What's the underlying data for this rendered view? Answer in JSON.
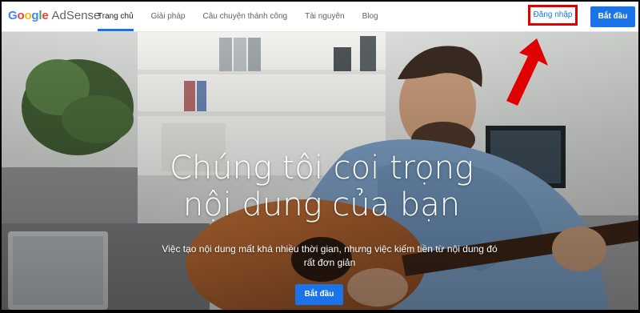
{
  "header": {
    "logo_google": [
      "G",
      "o",
      "o",
      "g",
      "l",
      "e"
    ],
    "logo_product": "AdSense",
    "nav": [
      {
        "label": "Trang chủ",
        "active": true
      },
      {
        "label": "Giải pháp",
        "active": false
      },
      {
        "label": "Câu chuyện thành công",
        "active": false
      },
      {
        "label": "Tài nguyên",
        "active": false
      },
      {
        "label": "Blog",
        "active": false
      }
    ],
    "login_label": "Đăng nhập",
    "start_label": "Bắt đầu"
  },
  "hero": {
    "title_line1": "Chúng tôi coi trọng",
    "title_line2": "nội dung của bạn",
    "subtitle_line1": "Việc tạo nội dung mất khá nhiều thời gian, nhưng việc kiếm tiền từ nội dung đó",
    "subtitle_line2": "rất đơn giản",
    "cta_label": "Bắt đầu"
  },
  "colors": {
    "accent": "#1a73e8",
    "highlight_box": "#e00000",
    "annotation_arrow": "#e00000",
    "google_letters": [
      "#4285f4",
      "#ea4335",
      "#fbbc05",
      "#4285f4",
      "#34a853",
      "#ea4335"
    ]
  },
  "icons": {
    "annotation": "red-arrow-icon"
  }
}
